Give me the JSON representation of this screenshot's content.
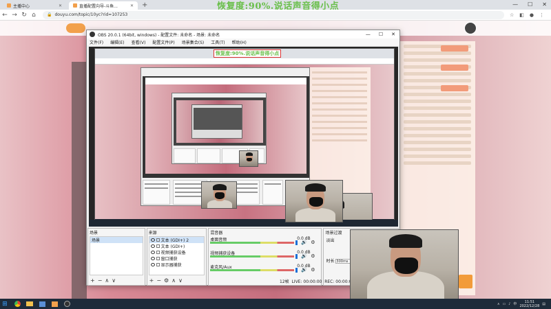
{
  "overlay_text": "恢复度:90%.说话声音得小点",
  "browser": {
    "tabs": [
      {
        "title": "主播中心",
        "active": false
      },
      {
        "title": "直播配置向导-斗鱼...",
        "active": true
      }
    ],
    "new_tab": "+",
    "window_controls": [
      "—",
      "☐",
      "✕"
    ],
    "url": "douyu.com/topic/10yc?rid=107253",
    "nav": {
      "back": "←",
      "forward": "→",
      "reload": "↻",
      "home": "⌂"
    }
  },
  "obs": {
    "title": "OBS 20.0.1 (64bit, windows) - 配置文件: 未命名 - 场景: 未命名",
    "window_controls": [
      "—",
      "☐",
      "✕"
    ],
    "menu": [
      "文件(F)",
      "编辑(E)",
      "查看(V)",
      "配置文件(P)",
      "场景集合(S)",
      "工具(T)",
      "帮助(H)"
    ],
    "docks": {
      "scenes": {
        "header": "场景",
        "items": [
          "场景"
        ],
        "footer": [
          "+",
          "−",
          "∧",
          "∨"
        ]
      },
      "sources": {
        "header": "来源",
        "items": [
          "文本 (GDI+) 2",
          "文本 (GDI+)",
          "视频捕获设备",
          "窗口捕获",
          "显示器捕获"
        ],
        "footer": [
          "+",
          "−",
          "⚙",
          "∧",
          "∨"
        ]
      },
      "mixer": {
        "header": "混音器",
        "items": [
          {
            "name": "桌面音频",
            "level": "0.0 dB"
          },
          {
            "name": "视频捕获设备",
            "level": "0.0 dB"
          },
          {
            "name": "麦克风/Aux",
            "level": "0.0 dB"
          }
        ]
      },
      "transitions": {
        "header": "场景过渡",
        "mode": "淡出",
        "duration_label": "时长",
        "duration_value": "300ms",
        "footer": [
          "+",
          "−"
        ]
      }
    },
    "status": {
      "fps": "12帧",
      "live": "LIVE: 00:00:00",
      "rec": "REC: 00:00:00"
    }
  },
  "taskbar": {
    "start": "⊞",
    "clock_time": "11:51",
    "clock_date": "2022/12/28",
    "lang": "中"
  }
}
